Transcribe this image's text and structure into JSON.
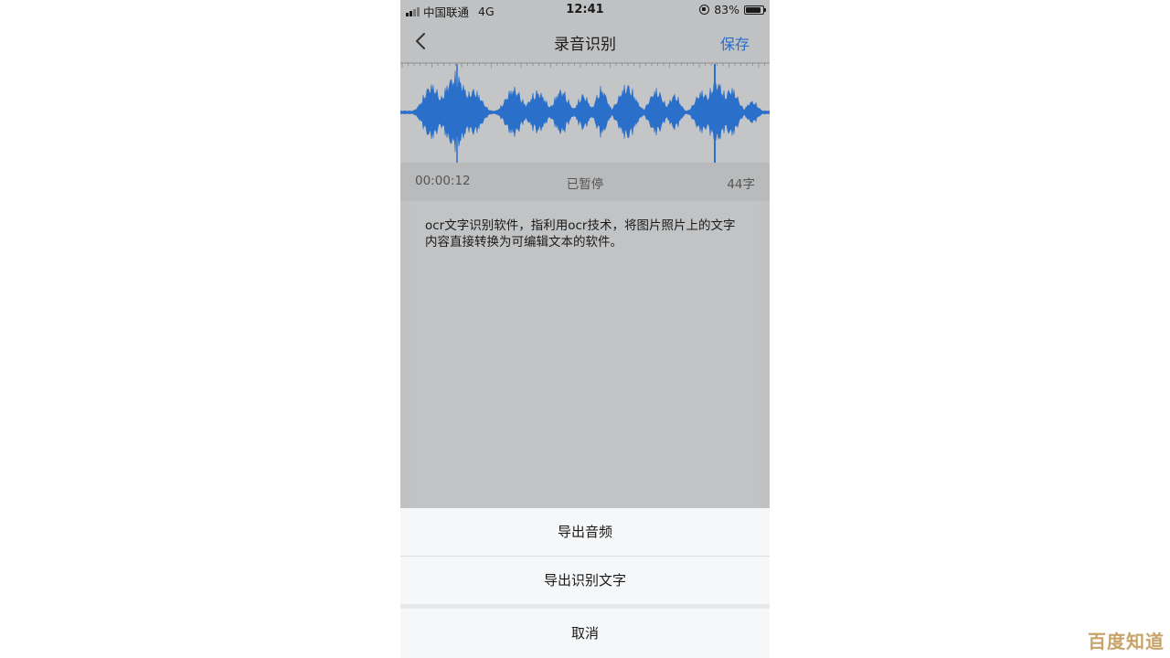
{
  "status_bar": {
    "carrier": "中国联通",
    "network": "4G",
    "time": "12:41",
    "battery": "83%"
  },
  "nav": {
    "back_icon": "chevron-left-icon",
    "title": "录音识别",
    "save_label": "保存"
  },
  "waveform": {
    "color": "#2a6fc9",
    "state": "paused"
  },
  "info": {
    "elapsed": "00:00:12",
    "status": "已暂停",
    "char_count": "44字"
  },
  "transcript": {
    "text": "ocr文字识别软件，指利用ocr技术，将图片照片上的文字内容直接转换为可编辑文本的软件。"
  },
  "action_sheet": {
    "export_audio": "导出音频",
    "export_text": "导出识别文字",
    "cancel": "取消"
  },
  "watermark": {
    "text": "百度知道"
  },
  "colors": {
    "accent": "#2a6fc9",
    "overlay_bg": "#c0c1c2",
    "watermark": "#c8a36a"
  }
}
